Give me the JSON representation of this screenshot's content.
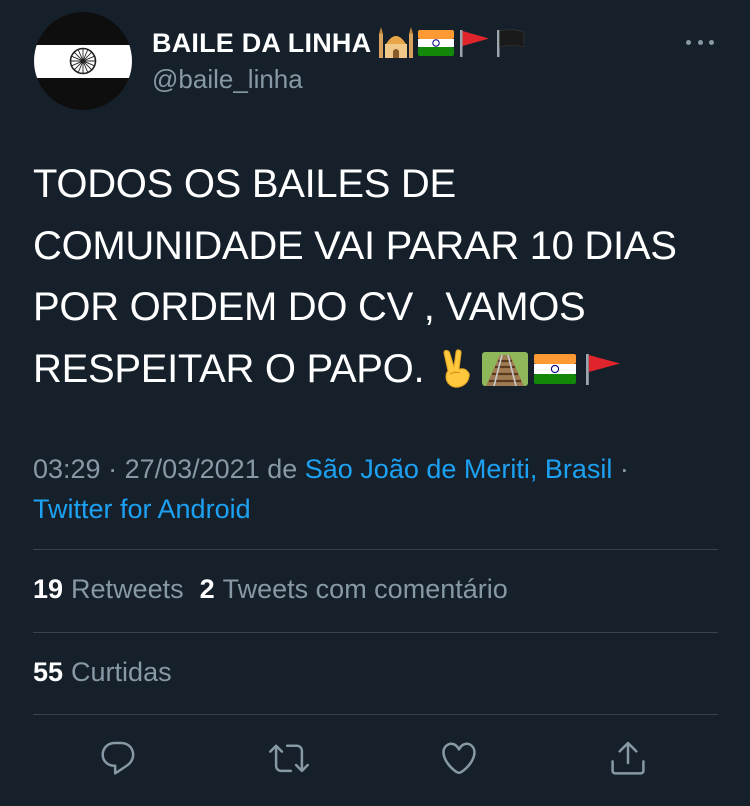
{
  "user": {
    "display_name": "BAILE DA LINHA",
    "handle": "@baile_linha",
    "name_emojis": [
      "mosque-emoji",
      "india-flag-emoji",
      "red-triangular-flag-emoji",
      "black-flag-emoji"
    ]
  },
  "tweet": {
    "lines": [
      "TODOS OS BAILES DE",
      "COMUNIDADE VAI PARAR 10 DIAS",
      "POR ORDEM DO CV , VAMOS",
      "RESPEITAR O PAPO."
    ],
    "text_emojis": [
      "victory-hand-emoji",
      "railway-track-emoji",
      "india-flag-emoji",
      "red-triangular-flag-emoji"
    ]
  },
  "meta": {
    "time": "03:29",
    "sep1": " · ",
    "date": "27/03/2021",
    "from": " de ",
    "location": "São João de Meriti, Brasil",
    "sep2": " ·",
    "source": "Twitter for Android"
  },
  "stats": {
    "retweets_count": "19",
    "retweets_label": "Retweets",
    "quotes_count": "2",
    "quotes_label": "Tweets com comentário",
    "likes_count": "55",
    "likes_label": "Curtidas"
  },
  "actions": [
    "reply-icon",
    "retweet-icon",
    "like-icon",
    "share-icon"
  ],
  "colors": {
    "background": "#15202b",
    "text": "#ffffff",
    "secondary": "#8899a6",
    "link": "#1da1f2",
    "divider": "#38444d"
  }
}
